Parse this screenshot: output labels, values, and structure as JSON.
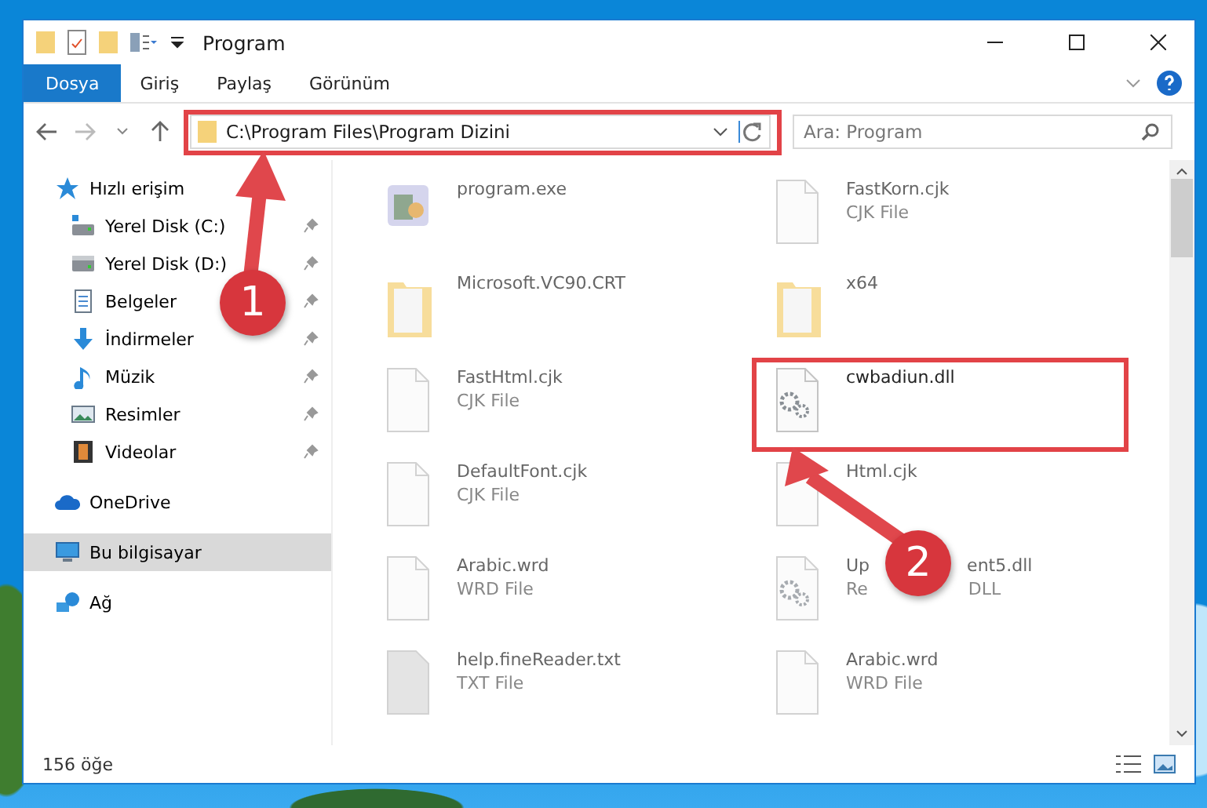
{
  "window": {
    "title": "Program"
  },
  "ribbon_tabs": [
    {
      "label": "Dosya",
      "selected": true
    },
    {
      "label": "Giriş",
      "selected": false
    },
    {
      "label": "Paylaş",
      "selected": false
    },
    {
      "label": "Görünüm",
      "selected": false
    }
  ],
  "address": {
    "path": "C:\\Program Files\\Program Dizini"
  },
  "search": {
    "placeholder": "Ara: Program"
  },
  "sidebar": {
    "items": [
      {
        "label": "Hızlı erişim",
        "selected": false,
        "children": [
          {
            "label": "Yerel Disk (C:)",
            "selected": false
          },
          {
            "label": "Yerel Disk (D:)",
            "selected": false
          },
          {
            "label": "Belgeler",
            "selected": false
          },
          {
            "label": "İndirmeler",
            "selected": false
          },
          {
            "label": "Müzik",
            "selected": false
          },
          {
            "label": "Resimler",
            "selected": false
          },
          {
            "label": "Videolar",
            "selected": false
          }
        ]
      },
      {
        "label": "OneDrive",
        "selected": false
      },
      {
        "label": "Bu bilgisayar",
        "selected": true
      },
      {
        "label": "Ağ",
        "selected": false
      }
    ]
  },
  "files": [
    {
      "name": [
        "program.exe"
      ],
      "kind": "exe",
      "dimmed": true
    },
    {
      "name": [
        "FastKorn.cjk"
      ],
      "type": [
        "CJK File"
      ],
      "kind": "file",
      "dimmed": true
    },
    {
      "name": [
        "Microsoft.VC90.CRT"
      ],
      "kind": "folder",
      "dimmed": true
    },
    {
      "name": [
        "x64"
      ],
      "kind": "folder",
      "dimmed": true
    },
    {
      "name": [
        "FastHtml.cjk"
      ],
      "type": [
        "CJK File"
      ],
      "kind": "file",
      "dimmed": true
    },
    {
      "name": [
        "cwbadiun.dll"
      ],
      "kind": "dll",
      "dimmed": false
    },
    {
      "name": [
        "DefaultFont.cjk"
      ],
      "type": [
        "CJK File"
      ],
      "kind": "file",
      "dimmed": true
    },
    {
      "name": [
        "Html.cjk"
      ],
      "kind": "file",
      "dimmed": true
    },
    {
      "name": [
        "Arabic.wrd"
      ],
      "type": [
        "WRD File"
      ],
      "kind": "file",
      "dimmed": true
    },
    {
      "name": [
        "Up",
        "ent5.dll"
      ],
      "type": [
        "Re",
        "DLL"
      ],
      "kind": "dll",
      "dimmed": true
    },
    {
      "name": [
        "help.fineReader.txt"
      ],
      "type": [
        "TXT File"
      ],
      "kind": "txt",
      "dimmed": true
    },
    {
      "name": [
        "Arabic.wrd"
      ],
      "type": [
        "WRD File"
      ],
      "kind": "file",
      "dimmed": true
    }
  ],
  "annotations": [
    {
      "number": "1"
    },
    {
      "number": "2"
    }
  ],
  "status_bar": {
    "count": "156 öğe"
  }
}
